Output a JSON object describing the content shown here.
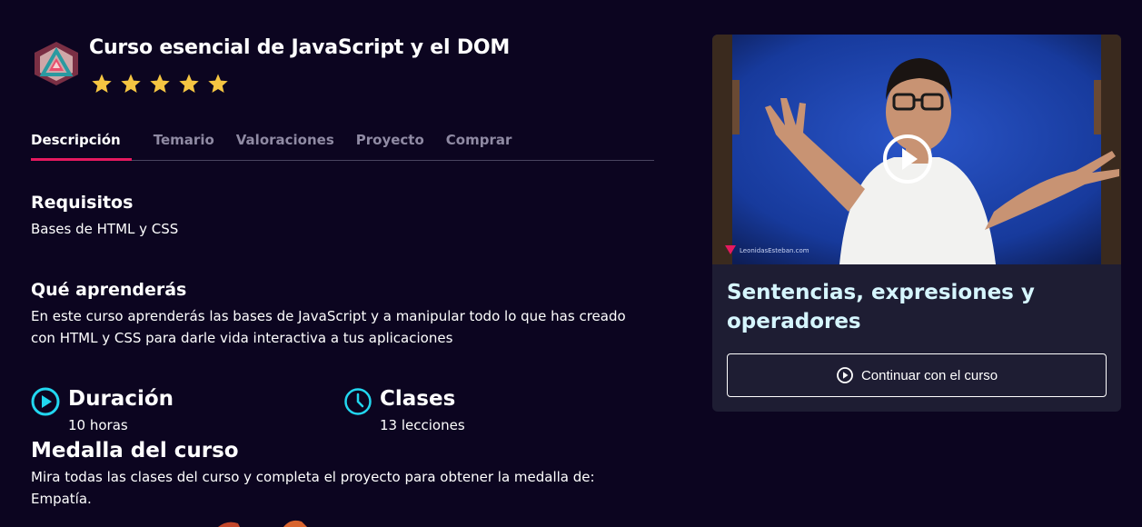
{
  "course": {
    "title": "Curso esencial de JavaScript y el DOM",
    "rating": 5,
    "rating_max": 5
  },
  "tabs": [
    {
      "label": "Descripción",
      "active": true
    },
    {
      "label": "Temario",
      "active": false
    },
    {
      "label": "Valoraciones",
      "active": false
    },
    {
      "label": "Proyecto",
      "active": false
    },
    {
      "label": "Comprar",
      "active": false
    }
  ],
  "requirements": {
    "title": "Requisitos",
    "text": "Bases de HTML y CSS"
  },
  "learn": {
    "title": "Qué aprenderás",
    "text": "En este curso aprenderás las bases de JavaScript y a manipular todo lo que has creado con HTML y CSS para darle vida interactiva a tus aplicaciones"
  },
  "stats": {
    "duration": {
      "title": "Duración",
      "value": "10 horas",
      "icon": "play-circle-icon"
    },
    "classes": {
      "title": "Clases",
      "value": "13 lecciones",
      "icon": "clock-icon"
    }
  },
  "medal": {
    "title": "Medalla del curso",
    "text": "Mira todas las clases del curso y completa el proyecto para obtener la medalla de: Empatía."
  },
  "card": {
    "lesson_title": "Sentencias, expresiones y operadores",
    "continue_label": "Continuar con el curso",
    "video_watermark": "LeonidasEsteban.com"
  },
  "colors": {
    "background": "#0c0520",
    "accent": "#e5195f",
    "icon_cyan": "#22d7f0",
    "star": "#f5c542",
    "card": "#1e1d33"
  }
}
